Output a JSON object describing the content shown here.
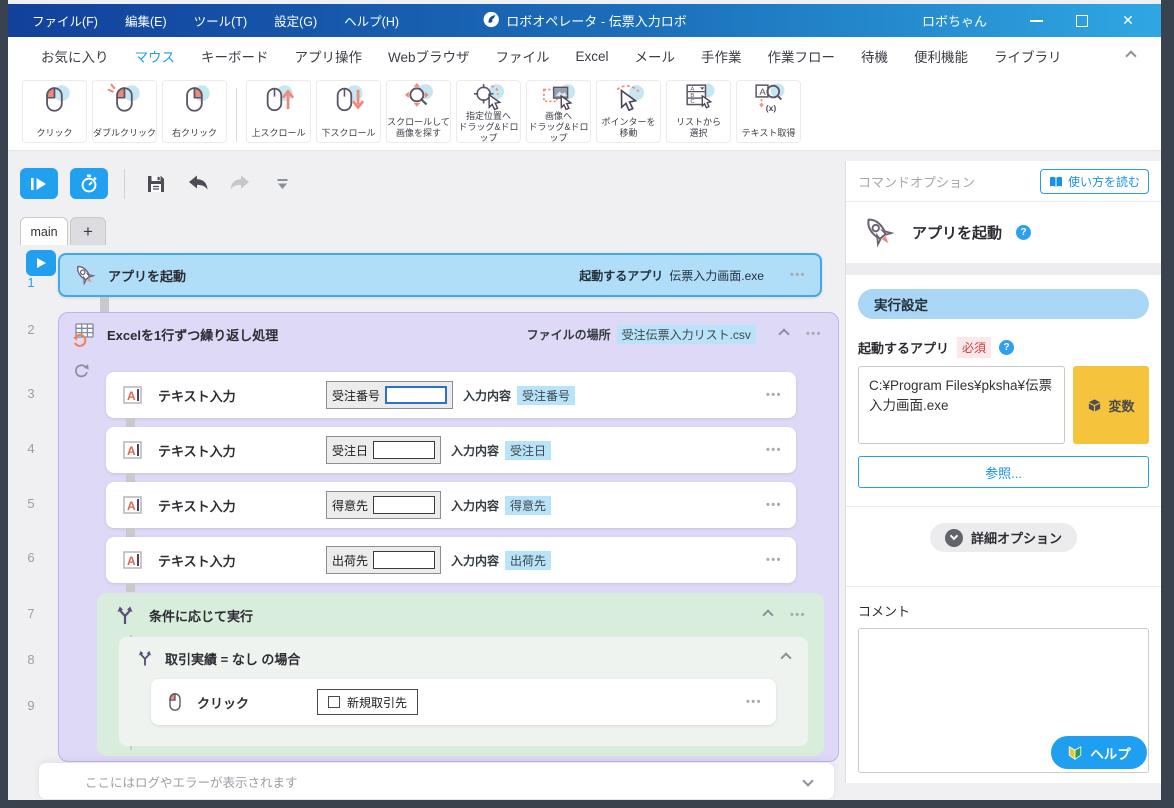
{
  "titlebar": {
    "menus": [
      "ファイル(F)",
      "編集(E)",
      "ツール(T)",
      "設定(G)",
      "ヘルプ(H)"
    ],
    "title": "ロボオペレータ - 伝票入力ロボ",
    "user_label": "ロボちゃん"
  },
  "icons": {
    "close": "✕",
    "more": "•••",
    "question": "?"
  },
  "ribbon": {
    "active_tab": "マウス",
    "tabs": [
      "お気に入り",
      "マウス",
      "キーボード",
      "アプリ操作",
      "Webブラウザ",
      "ファイル",
      "Excel",
      "メール",
      "手作業",
      "作業フロー",
      "待機",
      "便利機能",
      "ライブラリ"
    ],
    "tools": [
      {
        "icon": "mouse-click-icon",
        "label": "クリック"
      },
      {
        "icon": "mouse-double-click-icon",
        "label": "ダブルクリック"
      },
      {
        "icon": "mouse-right-click-icon",
        "label": "右クリック"
      },
      {
        "icon": "scroll-up-icon",
        "label": "上スクロール"
      },
      {
        "icon": "scroll-down-icon",
        "label": "下スクロール"
      },
      {
        "icon": "scroll-find-image-icon",
        "label": "スクロールして\n画像を探す"
      },
      {
        "icon": "drag-drop-to-position-icon",
        "label": "指定位置へ\nドラッグ&ドロップ"
      },
      {
        "icon": "drag-drop-to-image-icon",
        "label": "画像へ\nドラッグ&ドロップ"
      },
      {
        "icon": "move-pointer-icon",
        "label": "ポインターを\n移動"
      },
      {
        "icon": "select-from-list-icon",
        "label": "リストから\n選択"
      },
      {
        "icon": "get-text-icon",
        "label": "テキスト取得"
      }
    ]
  },
  "script_tabs": {
    "main": "main",
    "add": "+"
  },
  "flow": {
    "numbers": [
      "1",
      "2",
      "3",
      "4",
      "5",
      "6",
      "7",
      "8",
      "9"
    ],
    "step1": {
      "title": "アプリを起動",
      "param_label": "起動するアプリ",
      "param_value": "伝票入力画面.exe"
    },
    "step2": {
      "title": "Excelを1行ずつ繰り返し処理",
      "param_label": "ファイルの場所",
      "param_value": "受注伝票入力リスト.csv"
    },
    "inputs": [
      {
        "title": "テキスト入力",
        "thumb_label": "受注番号",
        "param_label": "入力内容",
        "param_value": "受注番号"
      },
      {
        "title": "テキスト入力",
        "thumb_label": "受注日",
        "param_label": "入力内容",
        "param_value": "受注日"
      },
      {
        "title": "テキスト入力",
        "thumb_label": "得意先",
        "param_label": "入力内容",
        "param_value": "得意先"
      },
      {
        "title": "テキスト入力",
        "thumb_label": "出荷先",
        "param_label": "入力内容",
        "param_value": "出荷先"
      }
    ],
    "step7": {
      "title": "条件に応じて実行"
    },
    "step8": {
      "title": "取引実績 = なし の場合"
    },
    "step9": {
      "title": "クリック",
      "thumb_label": "新規取引先"
    }
  },
  "logbar": {
    "placeholder": "ここにはログやエラーが表示されます"
  },
  "panel": {
    "header": "コマンドオプション",
    "read_usage": "使い方を読む",
    "command_title": "アプリを起動",
    "section_exec": "実行設定",
    "field_label": "起動するアプリ",
    "required": "必須",
    "app_path": "C:¥Program Files¥pksha¥伝票入力画面.exe",
    "variable_button": "変数",
    "browse_button": "参照...",
    "advanced_button": "詳細オプション",
    "comment_label": "コメント",
    "help_button": "ヘルプ"
  },
  "colors": {
    "accent_blue": "#21A0EF",
    "titlebar_gradient_start": "#12409B",
    "titlebar_gradient_end": "#2FA7E2",
    "selected_step_bg": "#B0DDF8",
    "selected_step_border": "#41A7EA",
    "loop_block_bg": "#DED9F6",
    "condition_block_bg": "#D8EDDB",
    "value_chip_bg": "#B9E3F8",
    "required_red": "#CF4040",
    "variable_orange": "#F6C33C"
  }
}
